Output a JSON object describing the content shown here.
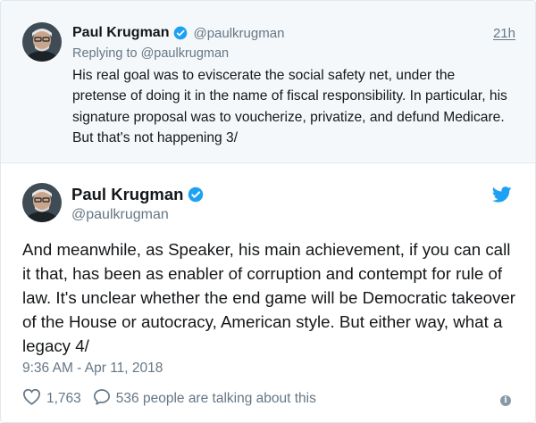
{
  "parent_tweet": {
    "author_name": "Paul Krugman",
    "handle": "@paulkrugman",
    "time_ago": "21h",
    "replying_to": "Replying to @paulkrugman",
    "text": "His real goal was to eviscerate the social safety net, under the pretense of doing it in the name of fiscal responsibility. In particular, his signature proposal was to voucherize, privatize, and defund Medicare. But that's not happening 3/"
  },
  "main_tweet": {
    "author_name": "Paul Krugman",
    "handle": "@paulkrugman",
    "text": "And meanwhile, as Speaker, his main achievement, if you can call it that, has been as enabler of corruption and contempt for rule of law. It's unclear whether the end game will be Democratic takeover of the House or autocracy, American style. But either way, what a legacy 4/",
    "timestamp": "9:36 AM - Apr 11, 2018",
    "likes": "1,763",
    "talking": "536 people are talking about this"
  },
  "icons": {
    "verified": "verified-badge-icon",
    "twitter": "twitter-bird-icon",
    "like": "heart-icon",
    "reply": "speech-bubble-icon",
    "info": "info-icon"
  },
  "colors": {
    "twitter_blue": "#1da1f2",
    "muted": "#657786",
    "parent_bg": "#f5f8fa"
  }
}
